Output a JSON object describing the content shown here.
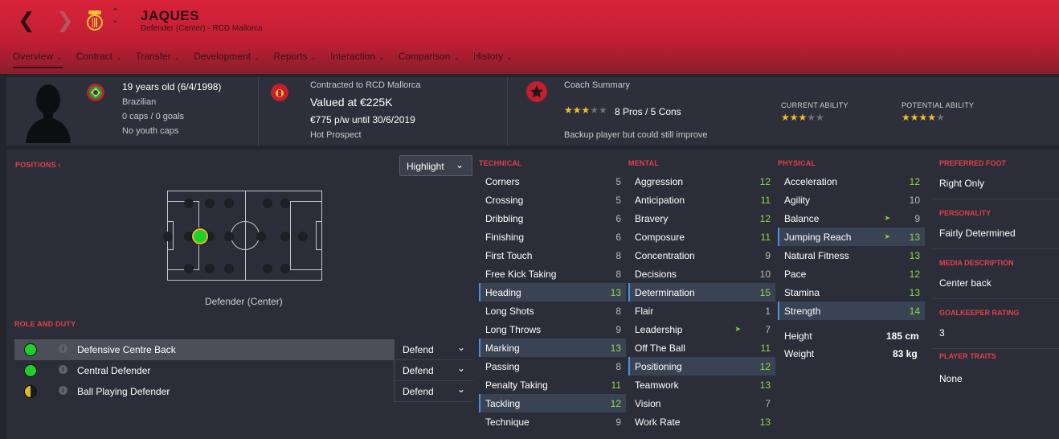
{
  "header": {
    "player_name": "JAQUES",
    "subtitle": "Defender (Center) - RCD Mallorca",
    "tabs": [
      "Overview",
      "Contract",
      "Transfer",
      "Development",
      "Reports",
      "Interaction",
      "Comparison",
      "History"
    ]
  },
  "info": {
    "age": "19 years old (6/4/1998)",
    "nationality": "Brazilian",
    "caps": "0 caps / 0 goals",
    "youth_caps": "No youth caps",
    "contracted": "Contracted to RCD Mallorca",
    "value": "Valued at €225K",
    "wage": "€775 p/w until 30/6/2019",
    "status": "Hot Prospect",
    "coach_summary_label": "Coach Summary",
    "pros_cons": "8 Pros / 5 Cons",
    "summary_text": "Backup player but could still improve",
    "current_ability_label": "CURRENT ABILITY",
    "potential_ability_label": "POTENTIAL ABILITY",
    "coach_stars": 3,
    "current_ability_stars": 3,
    "potential_ability_stars": 4
  },
  "positions": {
    "title": "POSITIONS",
    "highlight_label": "Highlight",
    "position_label": "Defender (Center)"
  },
  "roles": {
    "title": "ROLE AND DUTY",
    "items": [
      {
        "name": "Defensive Centre Back",
        "duty": "Defend"
      },
      {
        "name": "Central Defender",
        "duty": "Defend"
      },
      {
        "name": "Ball Playing Defender",
        "duty": "Defend"
      }
    ]
  },
  "technical": {
    "title": "TECHNICAL",
    "attrs": [
      {
        "name": "Corners",
        "value": "5"
      },
      {
        "name": "Crossing",
        "value": "5"
      },
      {
        "name": "Dribbling",
        "value": "6"
      },
      {
        "name": "Finishing",
        "value": "6"
      },
      {
        "name": "First Touch",
        "value": "8"
      },
      {
        "name": "Free Kick Taking",
        "value": "8"
      },
      {
        "name": "Heading",
        "value": "13"
      },
      {
        "name": "Long Shots",
        "value": "8"
      },
      {
        "name": "Long Throws",
        "value": "9"
      },
      {
        "name": "Marking",
        "value": "13"
      },
      {
        "name": "Passing",
        "value": "8"
      },
      {
        "name": "Penalty Taking",
        "value": "11"
      },
      {
        "name": "Tackling",
        "value": "12"
      },
      {
        "name": "Technique",
        "value": "9"
      }
    ]
  },
  "mental": {
    "title": "MENTAL",
    "attrs": [
      {
        "name": "Aggression",
        "value": "12"
      },
      {
        "name": "Anticipation",
        "value": "11"
      },
      {
        "name": "Bravery",
        "value": "12"
      },
      {
        "name": "Composure",
        "value": "11"
      },
      {
        "name": "Concentration",
        "value": "9"
      },
      {
        "name": "Decisions",
        "value": "10"
      },
      {
        "name": "Determination",
        "value": "15"
      },
      {
        "name": "Flair",
        "value": "1"
      },
      {
        "name": "Leadership",
        "value": "7"
      },
      {
        "name": "Off The Ball",
        "value": "11"
      },
      {
        "name": "Positioning",
        "value": "12"
      },
      {
        "name": "Teamwork",
        "value": "13"
      },
      {
        "name": "Vision",
        "value": "7"
      },
      {
        "name": "Work Rate",
        "value": "13"
      }
    ]
  },
  "physical": {
    "title": "PHYSICAL",
    "attrs": [
      {
        "name": "Acceleration",
        "value": "12"
      },
      {
        "name": "Agility",
        "value": "10"
      },
      {
        "name": "Balance",
        "value": "9"
      },
      {
        "name": "Jumping Reach",
        "value": "13"
      },
      {
        "name": "Natural Fitness",
        "value": "13"
      },
      {
        "name": "Pace",
        "value": "12"
      },
      {
        "name": "Stamina",
        "value": "13"
      },
      {
        "name": "Strength",
        "value": "14"
      }
    ],
    "height_label": "Height",
    "height": "185 cm",
    "weight_label": "Weight",
    "weight": "83 kg"
  },
  "details": {
    "preferred_foot_label": "PREFERRED FOOT",
    "preferred_foot": "Right Only",
    "personality_label": "PERSONALITY",
    "personality": "Fairly Determined",
    "media_label": "MEDIA DESCRIPTION",
    "media": "Center back",
    "gk_label": "GOALKEEPER RATING",
    "gk": "3",
    "traits_label": "PLAYER TRAITS",
    "traits": "None"
  },
  "colors": {
    "header_red": "#c11f33",
    "accent_red": "#e0404c",
    "attr_green": "#93d646",
    "star_gold": "#f3c21b",
    "highlight_blue": "#4a90e2"
  }
}
